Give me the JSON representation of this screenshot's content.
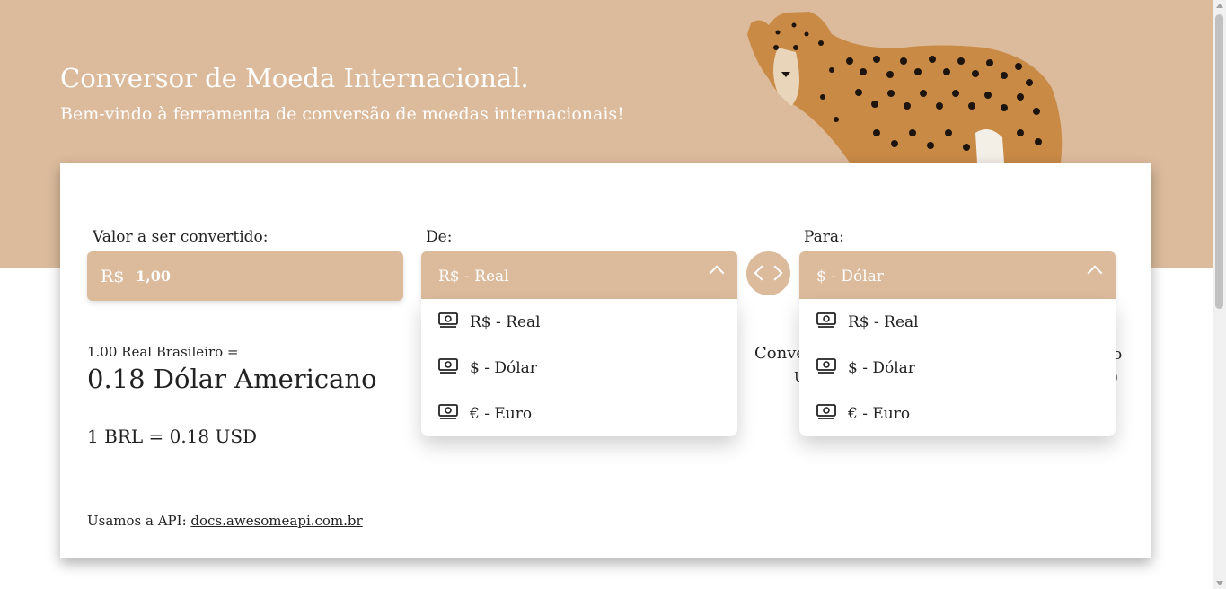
{
  "header": {
    "title": "Conversor de Moeda Internacional.",
    "subtitle": "Bem-vindo à ferramenta de conversão de moedas internacionais!"
  },
  "colors": {
    "accent": "#dcbb9c",
    "text": "#222222",
    "card": "#ffffff"
  },
  "form": {
    "amount_label": "Valor a ser convertido:",
    "amount_prefix": "R$",
    "amount_value": "1,00",
    "from_label": "De:",
    "from_value": "R$ - Real",
    "to_label": "Para:",
    "to_value": "$ - Dólar",
    "swap_icon": "swap-arrows-icon"
  },
  "currency_options": [
    {
      "label": "R$ - Real",
      "icon": "money-icon"
    },
    {
      "label": "$ - Dólar",
      "icon": "money-icon"
    },
    {
      "label": "€ - Euro",
      "icon": "money-icon"
    }
  ],
  "result": {
    "from_text": "1.00 Real Brasileiro =",
    "to_text": "0.18 Dólar Americano",
    "rate_text": "1 BRL = 0.18 USD",
    "right_partial_1": "Conve",
    "right_partial_2": "U",
    "right_partial_3": "o",
    "right_partial_4": ")"
  },
  "footer": {
    "prefix": "Usamos a API:",
    "link_text": "docs.awesomeapi.com.br"
  }
}
